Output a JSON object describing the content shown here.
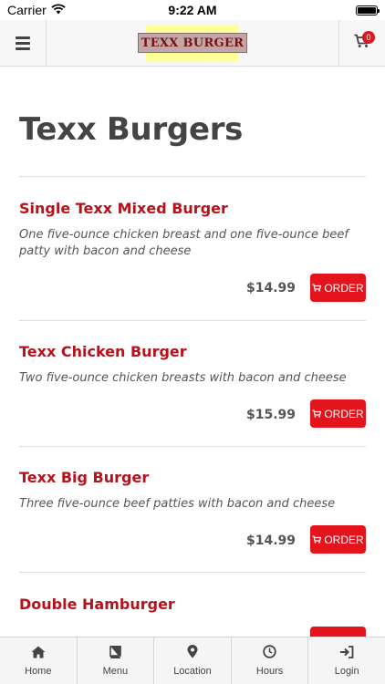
{
  "status_bar": {
    "carrier": "Carrier",
    "time": "9:22 AM"
  },
  "header": {
    "logo_text": "TEXX BURGER",
    "cart_count": "0"
  },
  "page": {
    "title": "Texx Burgers"
  },
  "items": [
    {
      "name": "Single Texx Mixed Burger",
      "description": "One five-ounce chicken breast and one five-ounce beef patty with bacon and cheese",
      "price": "$14.99",
      "order_label": "ORDER"
    },
    {
      "name": "Texx Chicken Burger",
      "description": "Two five-ounce chicken breasts with bacon and cheese",
      "price": "$15.99",
      "order_label": "ORDER"
    },
    {
      "name": "Texx Big Burger",
      "description": "Three five-ounce beef patties with bacon and cheese",
      "price": "$14.99",
      "order_label": "ORDER"
    },
    {
      "name": "Double Hamburger",
      "description": "",
      "price": "",
      "order_label": ""
    }
  ],
  "nav": [
    {
      "label": "Home",
      "icon": "home-icon"
    },
    {
      "label": "Menu",
      "icon": "book-icon"
    },
    {
      "label": "Location",
      "icon": "map-pin-icon"
    },
    {
      "label": "Hours",
      "icon": "clock-icon"
    },
    {
      "label": "Login",
      "icon": "sign-in-icon"
    }
  ],
  "colors": {
    "accent": "#e3141b",
    "item_name": "#b5121b",
    "logo_bg": "#ffff99"
  }
}
